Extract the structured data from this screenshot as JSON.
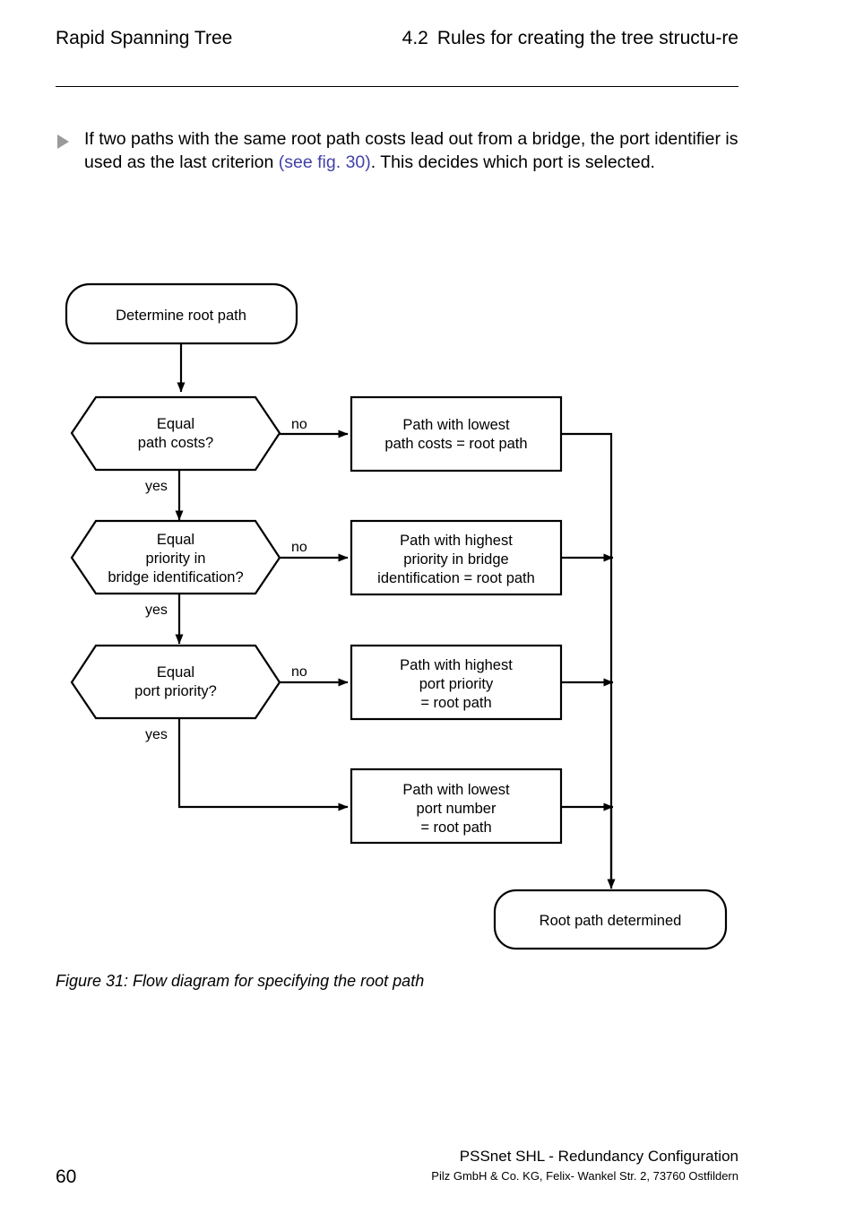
{
  "header": {
    "left_title": "Rapid Spanning Tree",
    "section_number": "4.2",
    "section_title": "Rules for creating the tree structu-re"
  },
  "body": {
    "bullet_marker": "triangle-bullet-icon",
    "paragraph_part1": "If two paths with the same root path costs lead out from a bridge, the port identifier is used as the last criterion ",
    "link_text": "(see fig. 30)",
    "paragraph_part2": ". This decides which port is selected."
  },
  "flowchart": {
    "start": "Determine root path",
    "end": "Root path determined",
    "decisions": [
      {
        "id": "equal-path-costs",
        "lines": [
          "Equal",
          "path costs?"
        ],
        "no_label": "no",
        "yes_label": "yes"
      },
      {
        "id": "equal-priority-bridge-identification",
        "lines": [
          "Equal",
          "priority in",
          "bridge identification?"
        ],
        "no_label": "no",
        "yes_label": "yes"
      },
      {
        "id": "equal-port-priority",
        "lines": [
          "Equal",
          "port priority?"
        ],
        "no_label": "no",
        "yes_label": "yes"
      }
    ],
    "actions": [
      {
        "id": "lowest-path-costs",
        "lines": [
          "Path with lowest",
          "path costs = root path"
        ]
      },
      {
        "id": "highest-priority-bridge-identification",
        "lines": [
          "Path with highest",
          "priority in bridge",
          "identification = root path"
        ]
      },
      {
        "id": "highest-port-priority",
        "lines": [
          "Path with highest",
          "port priority",
          "= root path"
        ]
      },
      {
        "id": "lowest-port-number",
        "lines": [
          "Path with lowest",
          "port number",
          "= root path"
        ]
      }
    ]
  },
  "caption": "Figure 31: Flow diagram for specifying the root path",
  "footer": {
    "page_number": "60",
    "title": "PSSnet SHL - Redundancy Configuration",
    "address": "Pilz GmbH & Co. KG, Felix- Wankel Str. 2, 73760 Ostfildern"
  },
  "colors": {
    "link": "#4242a8",
    "bullet": "#9a9a9a",
    "ink": "#000000",
    "paper": "#ffffff"
  }
}
